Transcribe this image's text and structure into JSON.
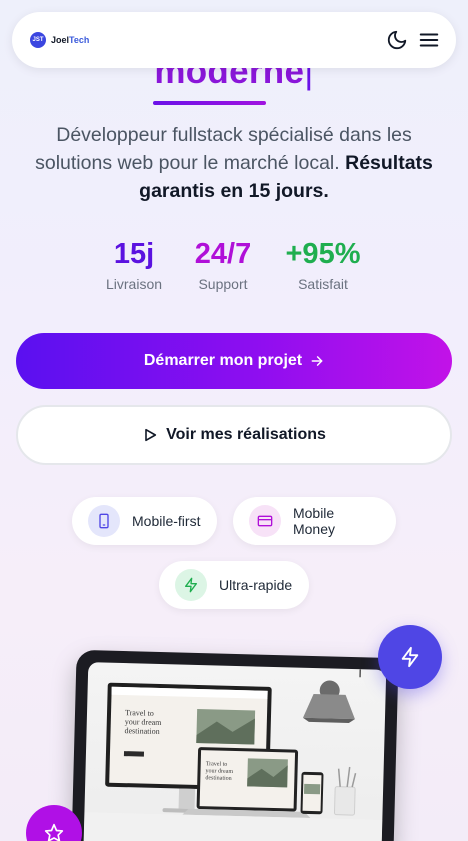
{
  "header": {
    "logo_mark": "JST",
    "brand_prefix": "Joel",
    "brand_suffix": "Tech",
    "icons": [
      "moon-icon",
      "menu-icon"
    ]
  },
  "hero": {
    "headline_fragment": "moderne",
    "cursor": "|",
    "subtitle_plain": "Développeur fullstack spécialisé dans les solutions web pour le marché local.",
    "subtitle_bold": "Résultats garantis en 15 jours."
  },
  "stats": [
    {
      "value": "15j",
      "label": "Livraison",
      "color": "#5b12e0"
    },
    {
      "value": "24/7",
      "label": "Support",
      "color": "#b010d8"
    },
    {
      "value": "+95%",
      "label": "Satisfait",
      "color": "#1fae4f"
    }
  ],
  "cta": {
    "primary_label": "Démarrer mon projet",
    "secondary_label": "Voir mes réalisations"
  },
  "features": [
    {
      "label": "Mobile-first",
      "icon": "phone-icon",
      "bg": "#e4e6fb",
      "color": "#4f46e5"
    },
    {
      "label": "Mobile Money",
      "icon": "card-icon",
      "bg": "#f7e2f7",
      "color": "#b010d8"
    },
    {
      "label": "Ultra-rapide",
      "icon": "bolt-icon",
      "bg": "#dcf5e5",
      "color": "#1fae4f"
    }
  ],
  "colors": {
    "primary_gradient_start": "#5a10f0",
    "primary_gradient_end": "#c212e8",
    "fab_bolt": "#4f46e5",
    "fab_star": "#b010e6"
  }
}
